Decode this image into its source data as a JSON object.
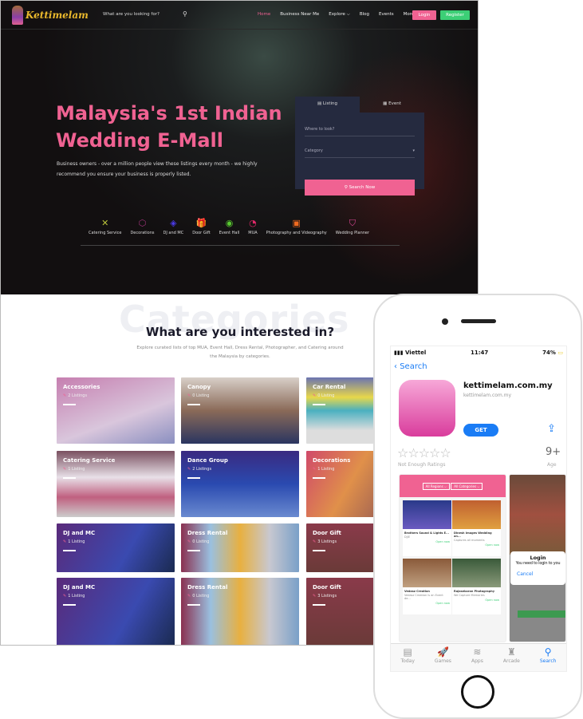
{
  "nav": {
    "logo": "Kettimelam",
    "search_placeholder": "What are you looking for?",
    "items": [
      "Home",
      "Business Near Me",
      "Explore ⌵",
      "Blog",
      "Events",
      "More ⌵"
    ],
    "login": "Login",
    "register": "Register"
  },
  "hero": {
    "title": "Malaysia's 1st Indian Wedding E-Mall",
    "subtitle": "Business owners - over a million people view these listings every month - we highly recommend you ensure your business is properly listed.",
    "search": {
      "tab_listing": "Listing",
      "tab_event": "Event",
      "where_placeholder": "Where to look?",
      "category_placeholder": "Category",
      "button": "Search Now"
    },
    "categories": [
      {
        "label": "Catering Service",
        "icon": "✕",
        "color": "#b8c23a"
      },
      {
        "label": "Decorations",
        "icon": "⬡",
        "color": "#a0347a"
      },
      {
        "label": "DJ and MC",
        "icon": "◈",
        "color": "#4a3ae8"
      },
      {
        "label": "Door Gift",
        "icon": "🎁",
        "color": "#f0e020"
      },
      {
        "label": "Event Hall",
        "icon": "◉",
        "color": "#58c830"
      },
      {
        "label": "MUA",
        "icon": "◔",
        "color": "#e02868"
      },
      {
        "label": "Photography and Videography",
        "icon": "▣",
        "color": "#f06a20"
      },
      {
        "label": "Wedding Planner",
        "icon": "⛉",
        "color": "#e04898"
      }
    ]
  },
  "categories": {
    "ghost": "Categories",
    "title": "What are you interested in?",
    "description": "Explore curated lists of top MUA, Event Hall, Dress Rental, Photographer, and Catering around the Malaysia by categories.",
    "cards": [
      {
        "title": "Accessories",
        "count": "2 Listings",
        "bg": "linear-gradient(160deg,#c67fb0,#d9c6dc 60%,#8a8fc0)"
      },
      {
        "title": "Canopy",
        "count": "0 Listing",
        "bg": "linear-gradient(#d8cfc8,#8a6a58 50%,#2a3560)"
      },
      {
        "title": "Car Rental",
        "count": "0 Listing",
        "bg": "linear-gradient(#6a74b0,#e8d84a 30%,#4ab0c0 50%,#ddd 80%)"
      },
      {
        "title": "Catering Service",
        "count": "1 Listing",
        "bg": "linear-gradient(#7a5060,#e8e0e8 40%,#c06080 70%,#ccc)"
      },
      {
        "title": "Dance Group",
        "count": "2 Listings",
        "bg": "linear-gradient(#3a2a80,#2a4ab0 50%,#6a8ad0)"
      },
      {
        "title": "Decorations",
        "count": "1 Listing",
        "bg": "linear-gradient(120deg,#d04a6a,#e0904a 40%,#6a3a5a)"
      },
      {
        "title": "DJ and MC",
        "count": "1 Listing",
        "bg": "linear-gradient(120deg,#5a2a7a,#3a4ab0 60%,#1a2a50)"
      },
      {
        "title": "Dress Rental",
        "count": "0 Listing",
        "bg": "linear-gradient(90deg,#8a3050,#9ac0e0 25%,#e8b040 50%,#c8c8d0 75%,#7aa0c8)"
      },
      {
        "title": "Door Gift",
        "count": "3 Listings",
        "bg": "linear-gradient(#8a3a4a,#6a3a38)"
      },
      {
        "title": "DJ and MC",
        "count": "1 Listing",
        "bg": "linear-gradient(120deg,#5a2a7a,#3a4ab0 60%,#1a2a50)"
      },
      {
        "title": "Dress Rental",
        "count": "0 Listing",
        "bg": "linear-gradient(90deg,#8a3050,#9ac0e0 25%,#e8b040 50%,#c8c8d0 75%,#7aa0c8)"
      },
      {
        "title": "Door Gift",
        "count": "3 Listings",
        "bg": "linear-gradient(#8a3a4a,#6a3a38)"
      }
    ]
  },
  "phone": {
    "carrier": "Viettel",
    "time": "11:47",
    "battery": "74%",
    "back": "Search",
    "app_name": "kettimelam.com.my",
    "app_sub": "kettimelam.com.my",
    "get": "GET",
    "stars": "☆☆☆☆☆",
    "ratings": "Not Enough Ratings",
    "age": "9+",
    "age_label": "Age",
    "shot": {
      "regions": "All Regions ⌵",
      "categories": "All Categories ⌵",
      "listings": [
        {
          "name": "Brothers Sound & Lights E...",
          "desc": "DJ/E",
          "open": "Open now",
          "bg": "linear-gradient(#2a3a8a,#6a5ac0)"
        },
        {
          "name": "Dinesh Images Wedding an...",
          "desc": "Captures all moments",
          "open": "Open now",
          "bg": "linear-gradient(#c06030,#e0a040)"
        },
        {
          "name": "Vedasz Creation",
          "desc": "Vedasz Creation is an Event de...",
          "open": "Open now",
          "bg": "linear-gradient(#8a5a3a,#c0a080)"
        },
        {
          "name": "Rajasekaran Photography",
          "desc": "We Capture Memories",
          "open": "Open now",
          "bg": "linear-gradient(#3a5a3a,#8a9a7a)"
        }
      ],
      "dialog_title": "Login",
      "dialog_text": "You need to login to you",
      "cancel": "Cancel"
    },
    "tabs": [
      {
        "label": "Today",
        "icon": "▤"
      },
      {
        "label": "Games",
        "icon": "🚀"
      },
      {
        "label": "Apps",
        "icon": "≋"
      },
      {
        "label": "Arcade",
        "icon": "♜"
      },
      {
        "label": "Search",
        "icon": "⚲"
      }
    ]
  }
}
